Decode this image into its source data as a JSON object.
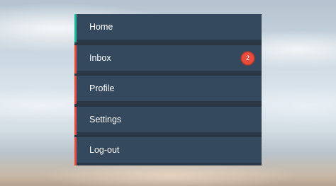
{
  "menu": {
    "items": [
      {
        "label": "Home",
        "accent": "#1abc9c"
      },
      {
        "label": "Inbox",
        "accent": "#e74c3c",
        "badge": "2"
      },
      {
        "label": "Profile",
        "accent": "#e74c3c"
      },
      {
        "label": "Settings",
        "accent": "#e74c3c"
      },
      {
        "label": "Log-out",
        "accent": "#e74c3c"
      }
    ]
  },
  "colors": {
    "item_background": "#34495e",
    "badge_background": "#e74c3c"
  }
}
